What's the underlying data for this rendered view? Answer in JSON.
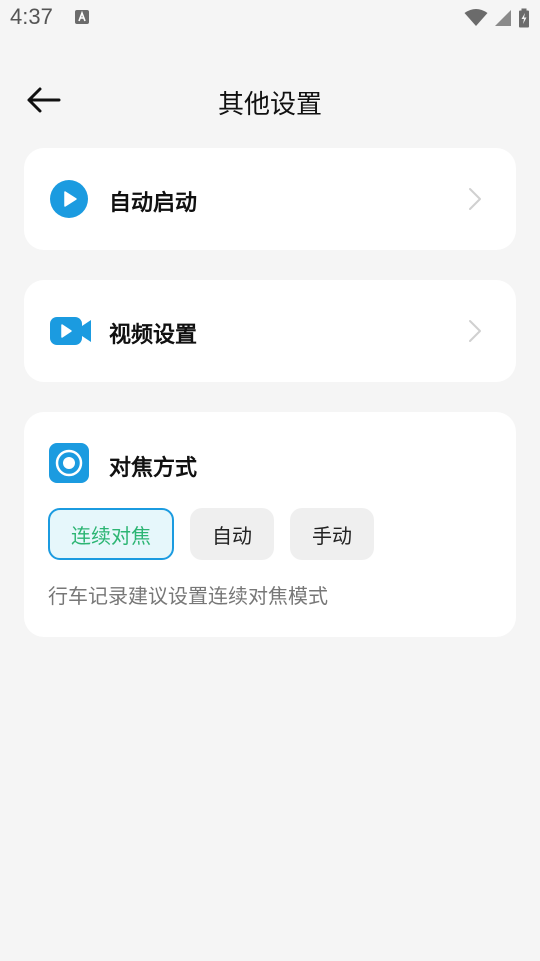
{
  "status_bar": {
    "time": "4:37",
    "notification_icon": "a-notification-icon",
    "wifi_icon": "wifi-icon",
    "signal_icon": "signal-icon",
    "battery_icon": "battery-charging-icon"
  },
  "header": {
    "title": "其他设置",
    "back_icon": "arrow-left-icon"
  },
  "settings": {
    "auto_start": {
      "label": "自动启动",
      "icon": "play-circle-icon"
    },
    "video_settings": {
      "label": "视频设置",
      "icon": "video-camera-icon"
    }
  },
  "focus_mode": {
    "title": "对焦方式",
    "icon": "focus-target-icon",
    "options": [
      {
        "label": "连续对焦",
        "selected": true
      },
      {
        "label": "自动",
        "selected": false
      },
      {
        "label": "手动",
        "selected": false
      }
    ],
    "hint": "行车记录建议设置连续对焦模式"
  },
  "colors": {
    "accent_blue": "#1b9be0",
    "selected_text_green": "#2cb573",
    "card_background": "#ffffff",
    "page_background": "#f5f5f5"
  }
}
